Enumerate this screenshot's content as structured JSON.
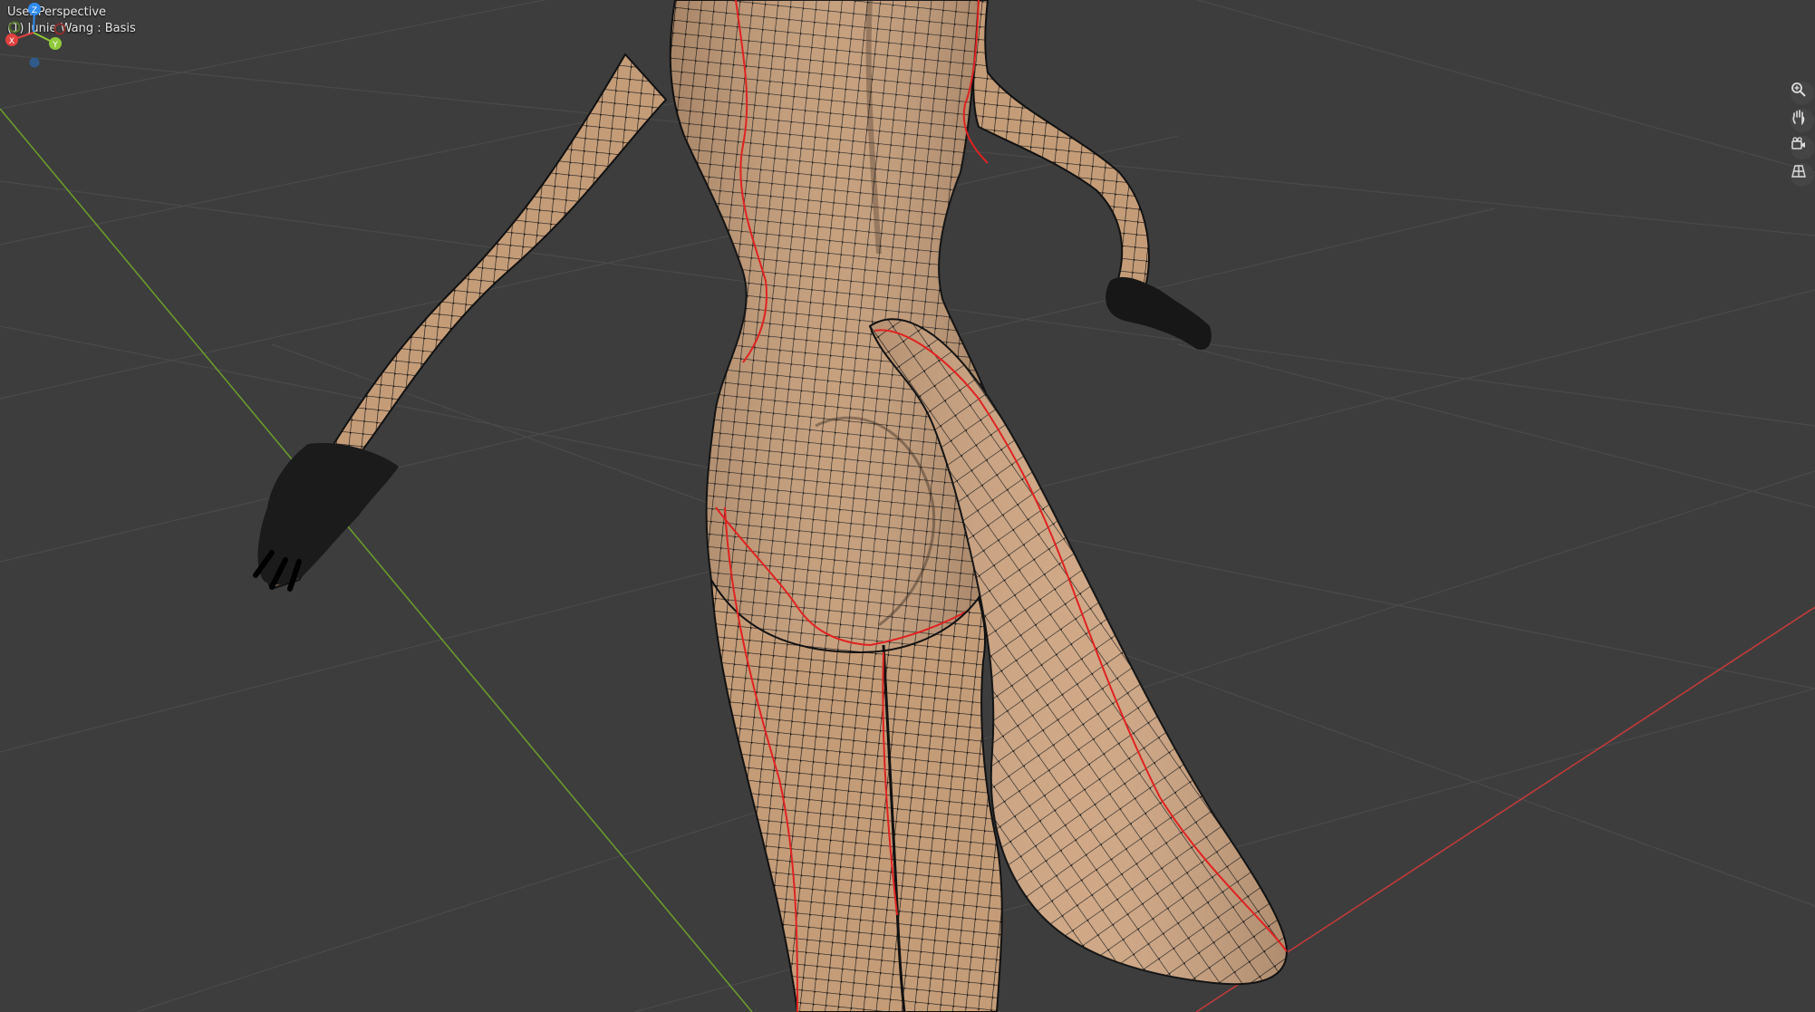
{
  "viewport": {
    "view_name": "User Perspective",
    "object_info": "(1) Junie Wang : Basis"
  },
  "gizmo": {
    "axes": [
      {
        "label": "Z",
        "color": "#2f8cf0"
      },
      {
        "label": "Y",
        "color": "#8fc93a"
      },
      {
        "label": "X",
        "color": "#e0413e"
      }
    ],
    "negative_colors": [
      "#2f5a8a",
      "#56722a",
      "#8a2f2e"
    ]
  },
  "nav_buttons": [
    {
      "name": "zoom-icon"
    },
    {
      "name": "pan-hand-icon"
    },
    {
      "name": "camera-view-icon"
    },
    {
      "name": "perspective-grid-icon"
    }
  ],
  "colors": {
    "background": "#3d3d3d",
    "grid_line": "#4b4b4b",
    "axis_x": "#c93c3c",
    "axis_y": "#6f9a2e",
    "skin": "#c9a07c",
    "wire": "#111111",
    "seam": "#e02222"
  }
}
